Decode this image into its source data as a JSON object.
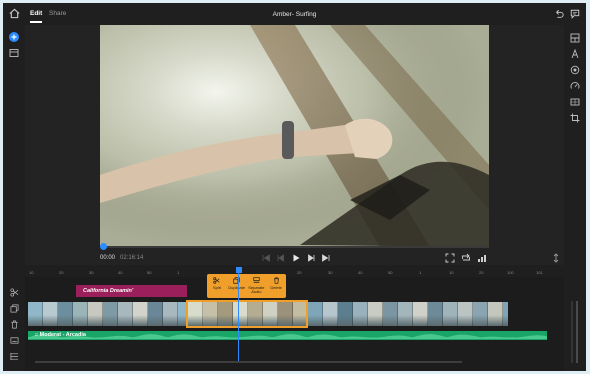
{
  "app": {
    "title": "Amber- Surfing",
    "tabs": [
      {
        "label": "Edit",
        "active": true
      },
      {
        "label": "Share",
        "active": false
      }
    ]
  },
  "transport": {
    "current_time": "00:00",
    "total_time": "02:16:14"
  },
  "timeline": {
    "ruler_labels": [
      "10",
      "20",
      "30",
      "40",
      "50",
      "1",
      "20",
      "30",
      "40",
      "50",
      "1",
      "10",
      "20",
      "100",
      "101"
    ],
    "title_clip": "California Dreamin'",
    "audio_clip": "Moderat - Arcadia",
    "context_menu": [
      {
        "label": "Split",
        "icon": "scissors-icon"
      },
      {
        "label": "Duplicate",
        "icon": "duplicate-icon"
      },
      {
        "label": "Separate Audio",
        "icon": "separate-audio-icon"
      },
      {
        "label": "Delete",
        "icon": "trash-icon"
      }
    ]
  },
  "colors": {
    "accent": "#2c8cff",
    "selection": "#f0a02a",
    "title_clip": "#9b1f5a",
    "audio": "#19a567"
  }
}
